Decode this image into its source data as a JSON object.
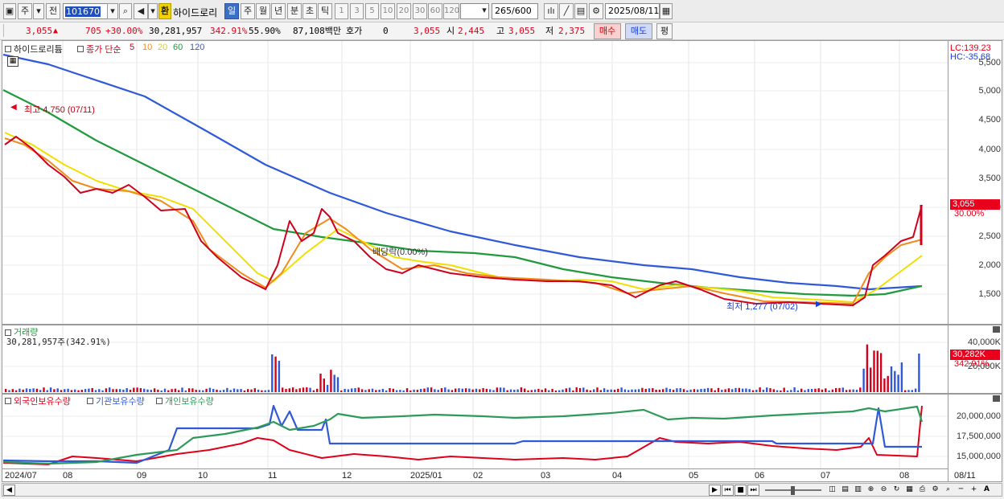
{
  "toolbar": {
    "market": "주",
    "prev": "전",
    "code": "101670",
    "name_badge": "환",
    "name": "하이드로리",
    "periods": [
      "일",
      "주",
      "월",
      "년",
      "분",
      "초",
      "틱"
    ],
    "minutes": [
      "1",
      "3",
      "5",
      "10",
      "20",
      "30",
      "60",
      "120"
    ],
    "count": "265",
    "count_total": "/600",
    "date": "2025/08/11"
  },
  "infobar": {
    "price": "3,055",
    "change": "705",
    "change_pct": "+30.00%",
    "volume": "30,281,957",
    "volume_pct": "342.91%",
    "ratio": "55.90%",
    "amount": "87,108백만",
    "hoga_label": "호가",
    "hoga_value": "0",
    "hoga_price": "3,055",
    "open_label": "시",
    "open": "2,445",
    "high_label": "고",
    "high": "3,055",
    "low_label": "저",
    "low": "2,375",
    "buy": "매수",
    "sell": "매도",
    "avg": "평"
  },
  "price_panel": {
    "title": "하이드로리튬",
    "ma_label": "종가 단순",
    "ma_periods": [
      "5",
      "10",
      "20",
      "60",
      "120"
    ],
    "ma_colors": [
      "#d0021b",
      "#f08c1e",
      "#f0e000",
      "#1f9a3c",
      "#2f59d8"
    ],
    "lc": "LC:139.23",
    "hc": "HC:-35.68",
    "y_ticks": [
      "5,000",
      "4,500",
      "4,000",
      "3,500",
      "3,000",
      "2,500",
      "2,000",
      "1,500"
    ],
    "y_top_partial": "5,500",
    "last_price_tag": "3,055",
    "last_pct_tag": "30.00%",
    "high_note": "최고 4,750 (07/11)",
    "low_note": "최저 1,277 (07/02)",
    "event_note": "배당락(0.00%)"
  },
  "volume_panel": {
    "title": "거래량",
    "value": "30,281,957주(342.91%)",
    "y_ticks": [
      "40,000K",
      "20,000K"
    ],
    "tag": "30,282K",
    "tag_pct": "342.91%"
  },
  "holding_panel": {
    "series": [
      "외국인보유수량",
      "기관보유수량",
      "개인보유수량"
    ],
    "colors": [
      "#e0001a",
      "#2f59d8",
      "#2e9a5a"
    ],
    "y_ticks": [
      "20,000,000",
      "17,500,000",
      "15,000,000"
    ]
  },
  "x_axis": [
    "2024/07",
    "08",
    "09",
    "10",
    "11",
    "12",
    "2025/01",
    "02",
    "03",
    "04",
    "05",
    "06",
    "07",
    "08"
  ],
  "x_last": "08/11",
  "colors": {
    "up": "#e0001a",
    "down": "#1a3cd8",
    "accent": "#3c6fc6"
  }
}
